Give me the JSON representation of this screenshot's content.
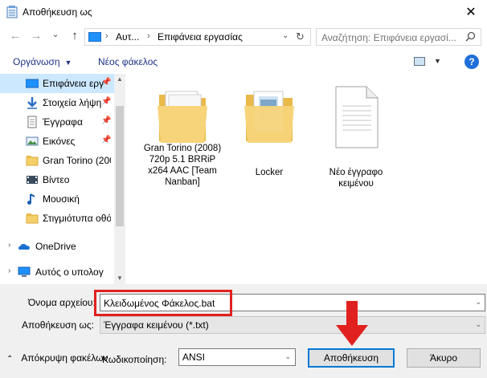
{
  "window": {
    "title": "Αποθήκευση ως",
    "close_glyph": "✕"
  },
  "nav": {
    "back_glyph": "←",
    "forward_glyph": "→",
    "recent_glyph": "⌄",
    "up_glyph": "↑",
    "breadcrumb": [
      "Αυτ...",
      "Επιφάνεια εργασίας"
    ],
    "search_placeholder": "Αναζήτηση: Επιφάνεια εργασί..."
  },
  "toolbar": {
    "organize_label": "Οργάνωση",
    "new_folder_label": "Νέος φάκελος",
    "help_glyph": "?"
  },
  "sidebar": {
    "items": [
      {
        "label": "Επιφάνεια εργ",
        "icon": "desktop-icon",
        "pinned": true,
        "selected": true
      },
      {
        "label": "Στοιχεία λήψη",
        "icon": "download-icon",
        "pinned": true
      },
      {
        "label": "Έγγραφα",
        "icon": "documents-icon",
        "pinned": true
      },
      {
        "label": "Εικόνες",
        "icon": "pictures-icon",
        "pinned": true
      },
      {
        "label": "Gran Torino (200",
        "icon": "folder-icon"
      },
      {
        "label": "Βίντεο",
        "icon": "videos-icon"
      },
      {
        "label": "Μουσική",
        "icon": "music-icon"
      },
      {
        "label": "Στιγμιότυπα οθό",
        "icon": "folder-icon"
      },
      {
        "label": "OneDrive",
        "icon": "onedrive-icon"
      },
      {
        "label": "Αυτός ο υπολογι",
        "icon": "computer-icon"
      }
    ]
  },
  "files": [
    {
      "label": "Gran Torino (2008) 720p 5.1 BRRiP x264 AAC [Team Nanban]",
      "type": "folder"
    },
    {
      "label": "Locker",
      "type": "folder"
    },
    {
      "label": "Νέο έγγραφο κειμένου",
      "type": "text-document"
    }
  ],
  "form": {
    "filename_label": "Όνομα αρχείου:",
    "filename_value": "Κλειδωμένος Φάκελος.bat",
    "savetype_label": "Αποθήκευση ως:",
    "savetype_value": "Έγγραφα κειμένου (*.txt)",
    "hide_folders_label": "Απόκρυψη φακέλων",
    "encoding_label": "Κωδικοποίηση:",
    "encoding_value": "ANSI",
    "save_button": "Αποθήκευση",
    "cancel_button": "Άκυρο"
  },
  "colors": {
    "accent": "#0078d7",
    "selection": "#cce8ff",
    "highlight_red": "#e1211f",
    "link": "#1e3287"
  }
}
